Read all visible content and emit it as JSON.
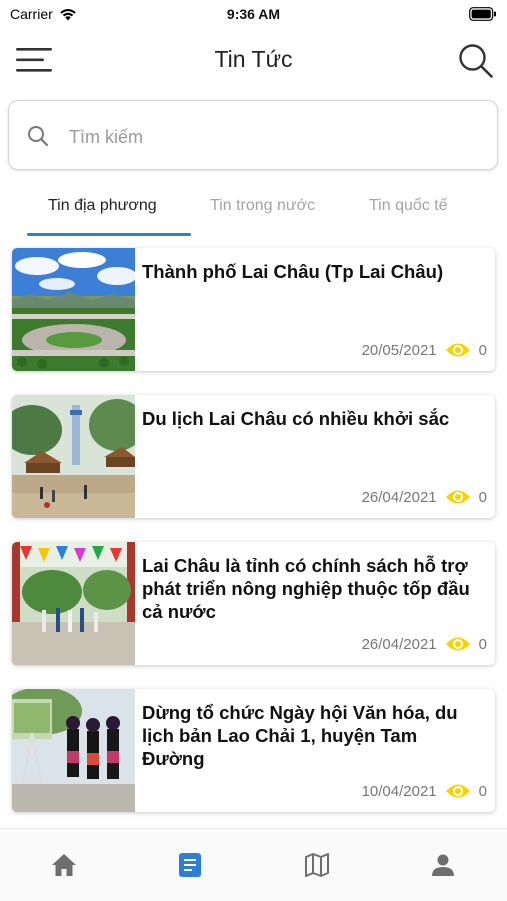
{
  "status_bar": {
    "carrier": "Carrier",
    "time": "9:36 AM"
  },
  "header": {
    "title": "Tin Tức",
    "menu_icon": "hamburger-menu-icon",
    "search_icon": "search-icon"
  },
  "search": {
    "placeholder": "Tìm kiếm",
    "value": ""
  },
  "tabs": [
    {
      "label": "Tin địa phương",
      "active": true
    },
    {
      "label": "Tin trong nước",
      "active": false
    },
    {
      "label": "Tin quốc tế",
      "active": false
    }
  ],
  "news": [
    {
      "title": "Thành phố Lai Châu (Tp Lai Châu)",
      "date": "20/05/2021",
      "views": "0"
    },
    {
      "title": "Du lịch Lai Châu có nhiều khởi sắc",
      "date": "26/04/2021",
      "views": "0"
    },
    {
      "title": "Lai Châu là tỉnh có chính sách hỗ trợ phát triển nông nghiệp thuộc tốp đầu cả nước",
      "date": "26/04/2021",
      "views": "0"
    },
    {
      "title": "Dừng tổ chức Ngày hội Văn hóa, du lịch bản Lao Chải 1, huyện Tam Đường",
      "date": "10/04/2021",
      "views": "0"
    }
  ],
  "bottom_nav": [
    {
      "icon": "home-icon",
      "active": false
    },
    {
      "icon": "news-icon",
      "active": true
    },
    {
      "icon": "map-icon",
      "active": false
    },
    {
      "icon": "profile-icon",
      "active": false
    }
  ],
  "colors": {
    "accent": "#2b7fd4",
    "eye": "#f5d400",
    "inactive_tab": "#a3a3a3",
    "inactive_nav": "#6e6e6e"
  }
}
